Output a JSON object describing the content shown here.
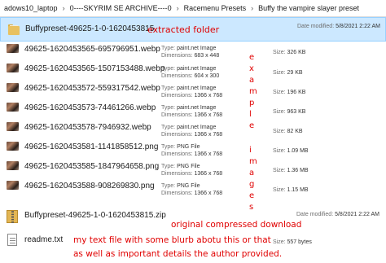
{
  "breadcrumb": {
    "items": [
      "adows10_laptop",
      "0----SKYRIM SE ARCHIVE----0",
      "Racemenu Presets",
      "Buffy the vampire slayer preset"
    ]
  },
  "labels": {
    "type": "Type:",
    "dimensions": "Dimensions:",
    "size": "Size:",
    "date_modified": "Date modified:"
  },
  "files": [
    {
      "name": "Buffypreset-49625-1-0-1620453815",
      "kind": "folder",
      "date": "5/8/2021 2:22 AM"
    },
    {
      "name": "49625-1620453565-695796951.webp",
      "kind": "image",
      "type": "paint.net Image",
      "dimensions": "683 x 448",
      "size": "326 KB"
    },
    {
      "name": "49625-1620453565-1507153488.webp",
      "kind": "image",
      "type": "paint.net Image",
      "dimensions": "604 x 300",
      "size": "29 KB"
    },
    {
      "name": "49625-1620453572-559317542.webp",
      "kind": "image",
      "type": "paint.net Image",
      "dimensions": "1366 x 768",
      "size": "196 KB"
    },
    {
      "name": "49625-1620453573-74461266.webp",
      "kind": "image",
      "type": "paint.net Image",
      "dimensions": "1366 x 768",
      "size": "963 KB"
    },
    {
      "name": "49625-1620453578-7946932.webp",
      "kind": "image",
      "type": "paint.net Image",
      "dimensions": "1366 x 768",
      "size": "82 KB"
    },
    {
      "name": "49625-1620453581-1141858512.png",
      "kind": "image",
      "type": "PNG File",
      "dimensions": "1366 x 768",
      "size": "1.09 MB"
    },
    {
      "name": "49625-1620453585-1847964658.png",
      "kind": "image",
      "type": "PNG File",
      "dimensions": "1366 x 768",
      "size": "1.36 MB"
    },
    {
      "name": "49625-1620453588-908269830.png",
      "kind": "image",
      "type": "PNG File",
      "dimensions": "1366 x 768",
      "size": "1.15 MB"
    },
    {
      "name": "Buffypreset-49625-1-0-1620453815.zip",
      "kind": "zip",
      "date": "5/8/2021 2:22 AM"
    },
    {
      "name": "readme.txt",
      "kind": "text",
      "size": "557 bytes"
    }
  ],
  "annotations": {
    "extracted": "extracted folder",
    "example_images_letters": [
      "e",
      "x",
      "a",
      "m",
      "p",
      "l",
      "e",
      "i",
      "m",
      "a",
      "g",
      "e",
      "s"
    ],
    "compressed": "original compressed download",
    "readme_line1": "my text file with some blurb abotu this or that",
    "readme_line2": "as well as important details the author provided."
  },
  "colors": {
    "annotation": "#e00000",
    "selection": "#cce8ff",
    "folder": "#e8c161"
  }
}
